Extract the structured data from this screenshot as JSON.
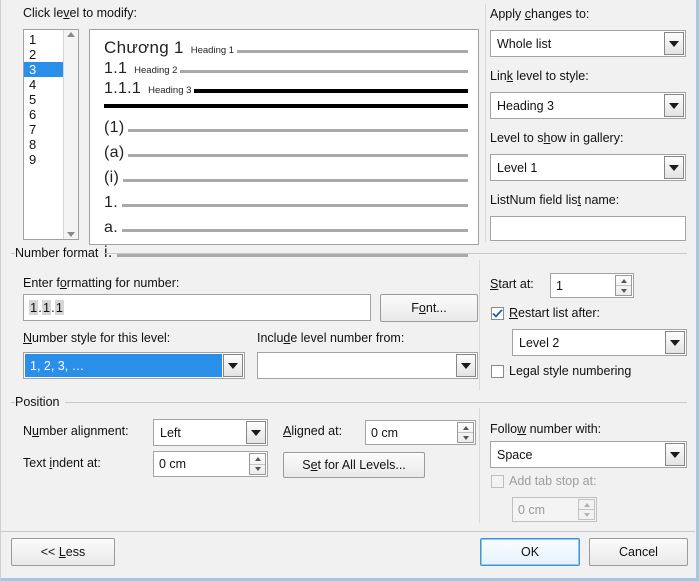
{
  "dialog": {
    "accent_selection": "#2a8fe8",
    "focus_border": "#3c97d4"
  },
  "left": {
    "click_level_label_pre": "Click le",
    "click_level_label_key": "v",
    "click_level_label_post": "el to modify:",
    "levels": [
      "1",
      "2",
      "3",
      "4",
      "5",
      "6",
      "7",
      "8",
      "9"
    ],
    "selected_level": "3",
    "scroll_up_icon": "scroll-up-arrow-icon",
    "scroll_down_icon": "scroll-down-arrow-icon"
  },
  "preview": {
    "headings": [
      {
        "number": "Chương 1",
        "style": "Heading 1",
        "rule": "gray"
      },
      {
        "number": "1.1",
        "style": "Heading 2",
        "rule": "gray"
      },
      {
        "number": "1.1.1",
        "style": "Heading 3",
        "rule": "black"
      }
    ],
    "body_levels": [
      {
        "number": "(1)"
      },
      {
        "number": "(a)"
      },
      {
        "number": "(i)"
      },
      {
        "number": "1."
      },
      {
        "number": "a."
      },
      {
        "number": "i."
      }
    ]
  },
  "apply": {
    "label_pre": "Apply ",
    "label_key": "c",
    "label_post": "hanges to:",
    "value": "Whole list",
    "caret_icon": "chevron-down-icon"
  },
  "link_level": {
    "label_pre": "Lin",
    "label_key": "k",
    "label_post": " level to style:",
    "value": "Heading 3",
    "caret_icon": "chevron-down-icon"
  },
  "gallery": {
    "label_pre": "Level to s",
    "label_key": "h",
    "label_post": "ow in gallery:",
    "value": "Level 1",
    "caret_icon": "chevron-down-icon"
  },
  "listnum": {
    "label_pre": "ListNum field lis",
    "label_key": "t",
    "label_post": " name:",
    "value": "",
    "placeholder": ""
  },
  "number_format": {
    "group_label": "Number format",
    "enter_fmt_label_pre": "Enter f",
    "enter_fmt_label_key": "o",
    "enter_fmt_label_post": "rmatting for number:",
    "fmt_parts": [
      "1",
      ".",
      "1",
      ".",
      "1"
    ],
    "font_button_pre": "F",
    "font_button_key": "o",
    "font_button_post": "nt...",
    "style_label_pre": "",
    "style_label_key": "N",
    "style_label_post": "umber style for this level:",
    "style_value": "1, 2, 3, …",
    "include_label_pre": "Inclu",
    "include_label_key": "d",
    "include_label_post": "e level number from:",
    "include_value": "",
    "start_at_label_pre": "",
    "start_at_label_key": "S",
    "start_at_label_post": "tart at:",
    "start_at_value": "1",
    "restart_label_pre": "",
    "restart_label_key": "R",
    "restart_label_post": "estart list after:",
    "restart_checked": true,
    "restart_value": "Level 2",
    "legal_label_pre": "Le",
    "legal_label_key": "g",
    "legal_label_post": "al style numbering",
    "legal_checked": false
  },
  "position": {
    "group_label": "Position",
    "num_align_label_pre": "N",
    "num_align_label_key": "u",
    "num_align_label_post": "mber alignment:",
    "num_align_value": "Left",
    "aligned_at_label_pre": "",
    "aligned_at_label_key": "A",
    "aligned_at_label_post": "ligned at:",
    "aligned_at_value": "0 cm",
    "text_indent_label_pre": "Text ",
    "text_indent_label_key": "i",
    "text_indent_label_post": "ndent at:",
    "text_indent_value": "0 cm",
    "set_all_pre": "S",
    "set_all_key": "e",
    "set_all_post": "t for All Levels...",
    "follow_label_pre": "Follo",
    "follow_label_key": "w",
    "follow_label_post": " number with:",
    "follow_value": "Space",
    "tab_stop_label": "Add tab stop at:",
    "tab_stop_checked": false,
    "tab_stop_value": "0 cm",
    "tab_stop_disabled": true
  },
  "footer": {
    "less_pre": "<< ",
    "less_key": "L",
    "less_post": "ess",
    "ok": "OK",
    "cancel": "Cancel"
  }
}
